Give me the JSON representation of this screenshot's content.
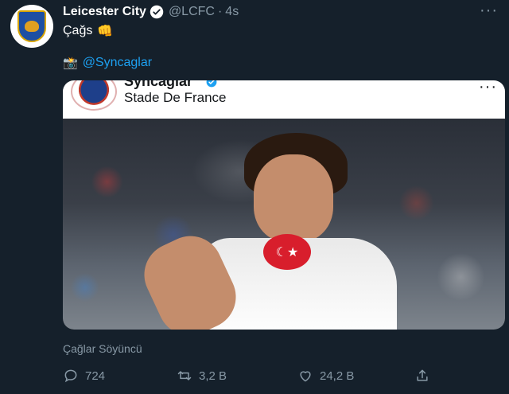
{
  "tweet": {
    "author_name": "Leicester City",
    "handle": "@LCFC",
    "separator": "·",
    "time": "4s",
    "more": "···",
    "text": "Çağs",
    "fist_emoji": "👊",
    "camera_emoji": "📸",
    "mention": "@Syncaglar",
    "caption": "Çağlar Söyüncü"
  },
  "embedded_card": {
    "name": "Syncaglar",
    "location": "Stade De France",
    "more": "···"
  },
  "actions": {
    "reply_count": "724",
    "retweet_count": "3,2 B",
    "like_count": "24,2 B"
  },
  "colors": {
    "background": "#15202b",
    "muted_text": "#8899a6",
    "link": "#1da1f2"
  },
  "icons": [
    "verified-badge-icon",
    "reply-icon",
    "retweet-icon",
    "like-icon",
    "share-icon"
  ]
}
